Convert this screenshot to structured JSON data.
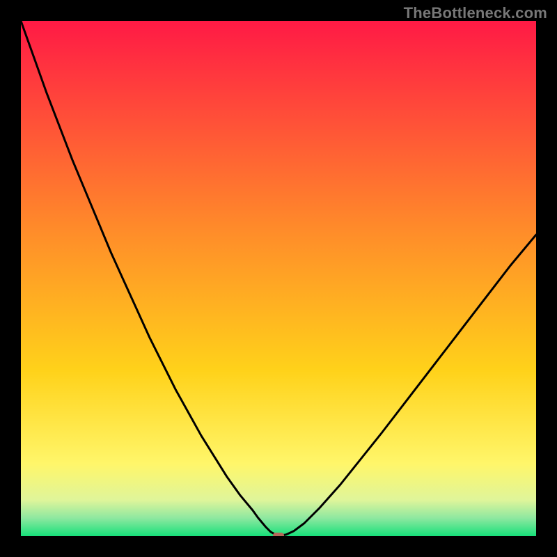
{
  "watermark": "TheBottleneck.com",
  "chart_data": {
    "type": "line",
    "title": "",
    "xlabel": "",
    "ylabel": "",
    "xlim": [
      0,
      100
    ],
    "ylim": [
      0,
      100
    ],
    "x": [
      0,
      2.5,
      5,
      7.5,
      10,
      12.5,
      15,
      17.5,
      20,
      22.5,
      25,
      27.5,
      30,
      32.5,
      35,
      37.5,
      40,
      42.5,
      45,
      46,
      47.5,
      48.5,
      50,
      51.5,
      53,
      55,
      58,
      62,
      66,
      70,
      75,
      80,
      85,
      90,
      95,
      100
    ],
    "y": [
      100,
      93,
      86,
      79.5,
      73,
      67,
      61,
      55,
      49.5,
      44,
      38.5,
      33.5,
      28.5,
      24,
      19.5,
      15.5,
      11.5,
      8,
      5,
      3.6,
      1.8,
      0.8,
      0,
      0.3,
      1,
      2.5,
      5.5,
      10,
      15,
      20,
      26.5,
      33,
      39.5,
      46,
      52.5,
      58.5
    ],
    "marker": {
      "x": 50,
      "y": 0
    },
    "background": {
      "type": "gradient",
      "stops": [
        {
          "pos": 0.0,
          "color": "#ff1a45"
        },
        {
          "pos": 0.4,
          "color": "#ff8a2a"
        },
        {
          "pos": 0.68,
          "color": "#ffd21a"
        },
        {
          "pos": 0.86,
          "color": "#fff66a"
        },
        {
          "pos": 0.93,
          "color": "#dff59a"
        },
        {
          "pos": 0.965,
          "color": "#8ee8a0"
        },
        {
          "pos": 1.0,
          "color": "#17e07a"
        }
      ]
    }
  }
}
